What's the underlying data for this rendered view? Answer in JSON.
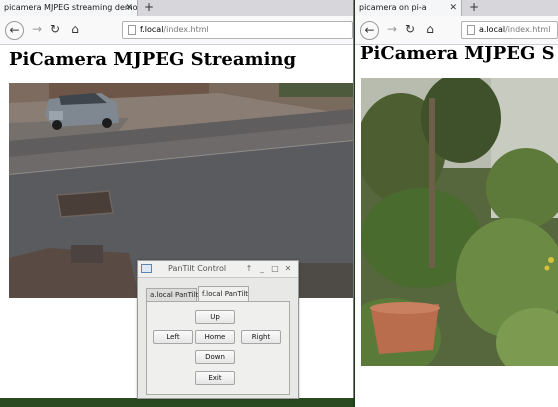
{
  "left_window": {
    "tab_title": "picamera MJPEG streaming demo",
    "url_host": "f.local",
    "url_path": "/index.html",
    "heading": "PiCamera MJPEG Streaming"
  },
  "right_window": {
    "tab_title": "picamera on pi-a",
    "url_host": "a.local",
    "url_path": "/index.html",
    "heading": "PiCamera MJPEG S"
  },
  "browser_icons": {
    "tab_close": "✕",
    "new_tab": "+",
    "back": "←",
    "forward": "→",
    "reload": "↻",
    "home": "⌂"
  },
  "dialog": {
    "title": "PanTilt Control",
    "controls": {
      "up": "↑",
      "minimize": "_",
      "maximize": "□",
      "close": "✕"
    },
    "tabs": [
      "a.local PanTilt",
      "f.local PanTilt"
    ],
    "active_tab_index": 1,
    "buttons": {
      "up": "Up",
      "left": "Left",
      "home": "Home",
      "right": "Right",
      "down": "Down",
      "exit": "Exit"
    }
  },
  "colors": {
    "desktop_bg": "#1f3a1a",
    "tab_strip": "#d7d7db",
    "dialog_bg": "#e8e8e7"
  }
}
